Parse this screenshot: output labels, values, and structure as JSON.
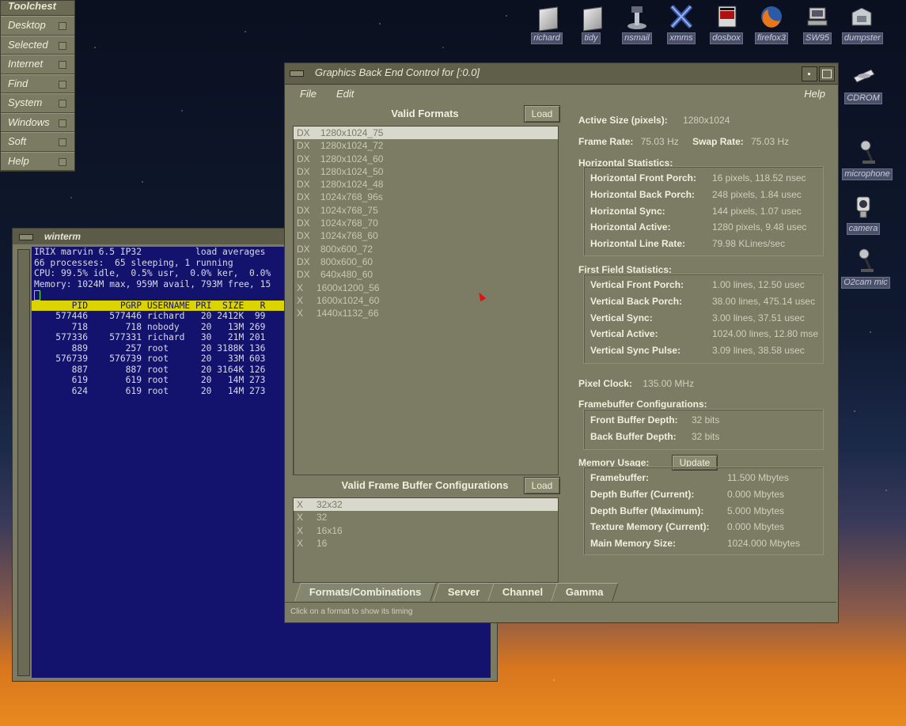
{
  "toolchest": {
    "title": "Toolchest",
    "items": [
      "Desktop",
      "Selected",
      "Internet",
      "Find",
      "System",
      "Windows",
      "Soft",
      "Help"
    ]
  },
  "desktop_icons": [
    {
      "label": "richard",
      "icon": "folder-icon"
    },
    {
      "label": "tidy",
      "icon": "folder-icon"
    },
    {
      "label": "nsmail",
      "icon": "mail-icon"
    },
    {
      "label": "xmms",
      "icon": "xmms-icon"
    },
    {
      "label": "dosbox",
      "icon": "dosbox-icon"
    },
    {
      "label": "firefox3",
      "icon": "firefox-icon"
    },
    {
      "label": "SW95",
      "icon": "computer-icon"
    },
    {
      "label": "dumpster",
      "icon": "dumpster-icon"
    },
    {
      "label": "CDROM",
      "icon": "cdrom-icon"
    },
    {
      "label": "microphone",
      "icon": "microphone-icon"
    },
    {
      "label": "camera",
      "icon": "camera-icon"
    },
    {
      "label": "O2cam mic",
      "icon": "microphone-icon"
    }
  ],
  "winterm": {
    "title": "winterm",
    "lines": [
      "IRIX marvin 6.5 IP32          load averages",
      "66 processes:  65 sleeping, 1 running",
      "CPU: 99.5% idle,  0.5% usr,  0.0% ker,  0.0%",
      "Memory: 1024M max, 959M avail, 793M free, 15"
    ],
    "header": "       PID      PGRP USERNAME PRI  SIZE   R",
    "rows": [
      "    577446    577446 richard   20 2412K  99",
      "       718       718 nobody    20   13M 269",
      "    577336    577331 richard   30   21M 201",
      "       889       257 root      20 3188K 136",
      "    576739    576739 root      20   33M 603",
      "       887       887 root      20 3164K 126",
      "       619       619 root      20   14M 273",
      "       624       619 root      20   14M 273"
    ]
  },
  "gwin": {
    "title": "Graphics Back End Control for [:0.0]",
    "menu": {
      "file": "File",
      "edit": "Edit",
      "help": "Help"
    },
    "formats_header": "Valid Formats",
    "load_label": "Load",
    "formats": [
      {
        "flag": "DX",
        "name": "1280x1024_75",
        "selected": true
      },
      {
        "flag": "DX",
        "name": "1280x1024_72"
      },
      {
        "flag": "DX",
        "name": "1280x1024_60"
      },
      {
        "flag": "DX",
        "name": "1280x1024_50"
      },
      {
        "flag": "DX",
        "name": "1280x1024_48"
      },
      {
        "flag": "DX",
        "name": "1024x768_96s"
      },
      {
        "flag": "DX",
        "name": "1024x768_75"
      },
      {
        "flag": "DX",
        "name": "1024x768_70"
      },
      {
        "flag": "DX",
        "name": "1024x768_60"
      },
      {
        "flag": "DX",
        "name": "800x600_72"
      },
      {
        "flag": "DX",
        "name": "800x600_60"
      },
      {
        "flag": "DX",
        "name": "640x480_60"
      },
      {
        "flag": "X",
        "name": "1600x1200_56"
      },
      {
        "flag": "X",
        "name": "1600x1024_60"
      },
      {
        "flag": "X",
        "name": "1440x1132_66"
      }
    ],
    "fb_header": "Valid Frame Buffer Configurations",
    "fb_configs": [
      {
        "flag": "X",
        "name": "32x32",
        "selected": true
      },
      {
        "flag": "X",
        "name": "32"
      },
      {
        "flag": "X",
        "name": "16x16"
      },
      {
        "flag": "X",
        "name": "16"
      }
    ],
    "active_size": {
      "label": "Active Size (pixels):",
      "value": "1280x1024"
    },
    "frame_rate": {
      "label": "Frame Rate:",
      "value": "75.03 Hz"
    },
    "swap_rate": {
      "label": "Swap Rate:",
      "value": "75.03 Hz"
    },
    "horiz": {
      "title": "Horizontal Statistics:",
      "rows": [
        {
          "k": "Horizontal Front Porch:",
          "v": "16 pixels, 118.52 nsec"
        },
        {
          "k": "Horizontal Back Porch:",
          "v": "248 pixels, 1.84 usec"
        },
        {
          "k": "Horizontal Sync:",
          "v": "144 pixels, 1.07 usec"
        },
        {
          "k": "Horizontal Active:",
          "v": "1280 pixels, 9.48 usec"
        },
        {
          "k": "Horizontal Line Rate:",
          "v": "79.98 KLines/sec"
        }
      ]
    },
    "field": {
      "title": "First Field Statistics:",
      "rows": [
        {
          "k": "Vertical Front Porch:",
          "v": "1.00 lines, 12.50 usec"
        },
        {
          "k": "Vertical Back Porch:",
          "v": "38.00 lines, 475.14 usec"
        },
        {
          "k": "Vertical Sync:",
          "v": "3.00 lines, 37.51 usec"
        },
        {
          "k": "Vertical Active:",
          "v": "1024.00 lines, 12.80 mse"
        },
        {
          "k": "Vertical Sync Pulse:",
          "v": "3.09 lines, 38.58 usec"
        }
      ]
    },
    "pixel_clock": {
      "label": "Pixel Clock:",
      "value": "135.00 MHz"
    },
    "fbconf": {
      "title": "Framebuffer Configurations:",
      "rows": [
        {
          "k": "Front Buffer Depth:",
          "v": "32 bits"
        },
        {
          "k": "Back Buffer Depth:",
          "v": "32 bits"
        }
      ]
    },
    "memory": {
      "title": "Memory Usage:",
      "update_label": "Update",
      "rows": [
        {
          "k": "Framebuffer:",
          "v": "11.500 Mbytes"
        },
        {
          "k": "Depth Buffer (Current):",
          "v": "0.000 Mbytes"
        },
        {
          "k": "Depth Buffer (Maximum):",
          "v": "5.000 Mbytes"
        },
        {
          "k": "Texture Memory (Current):",
          "v": "0.000 Mbytes"
        },
        {
          "k": "Main Memory Size:",
          "v": "1024.000 Mbytes"
        }
      ]
    },
    "tabs": [
      "Formats/Combinations",
      "Server",
      "Channel",
      "Gamma"
    ],
    "status": "Click on a format to show its timing"
  }
}
